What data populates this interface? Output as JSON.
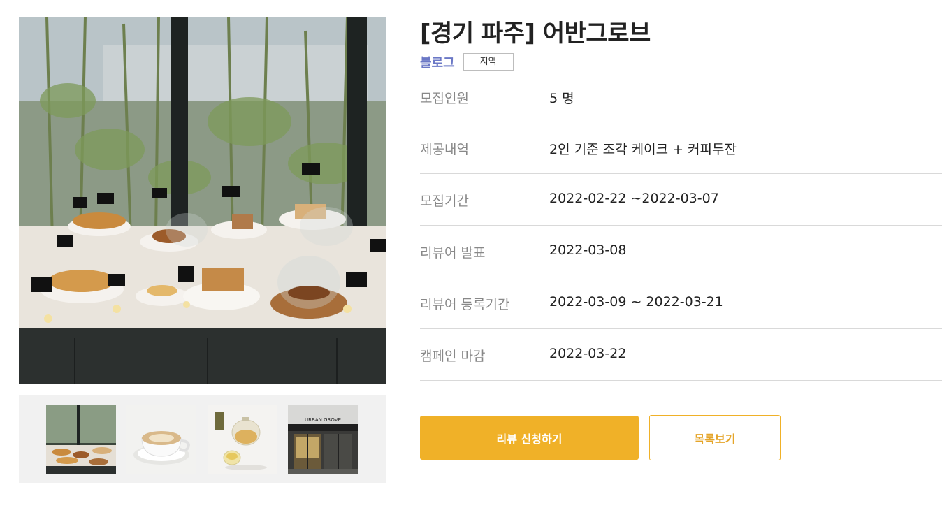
{
  "campaign": {
    "title": "[경기 파주] 어반그로브",
    "channel": "블로그",
    "type_tag": "지역"
  },
  "details": [
    {
      "label": "모집인원",
      "value": "5 명"
    },
    {
      "label": "제공내역",
      "value": "2인 기준 조각 케이크 + 커피두잔"
    },
    {
      "label": "모집기간",
      "value": "2022-02-22 ~2022-03-07"
    },
    {
      "label": "리뷰어 발표",
      "value": "2022-03-08"
    },
    {
      "label": "리뷰어 등록기간",
      "value": "2022-03-09 ~ 2022-03-21"
    },
    {
      "label": "캠페인 마감",
      "value": "2022-03-22"
    }
  ],
  "actions": {
    "apply_label": "리뷰 신청하기",
    "list_label": "목록보기"
  },
  "gallery": {
    "thumbnails": [
      {
        "icon": "pastry-display-photo"
      },
      {
        "icon": "cappuccino-photo"
      },
      {
        "icon": "tea-pot-photo"
      },
      {
        "icon": "storefront-photo",
        "sign_text": "URBAN GROVE"
      }
    ]
  },
  "colors": {
    "accent": "#f0b128",
    "channel": "#6b78c6",
    "divider": "#d9d9d9"
  }
}
